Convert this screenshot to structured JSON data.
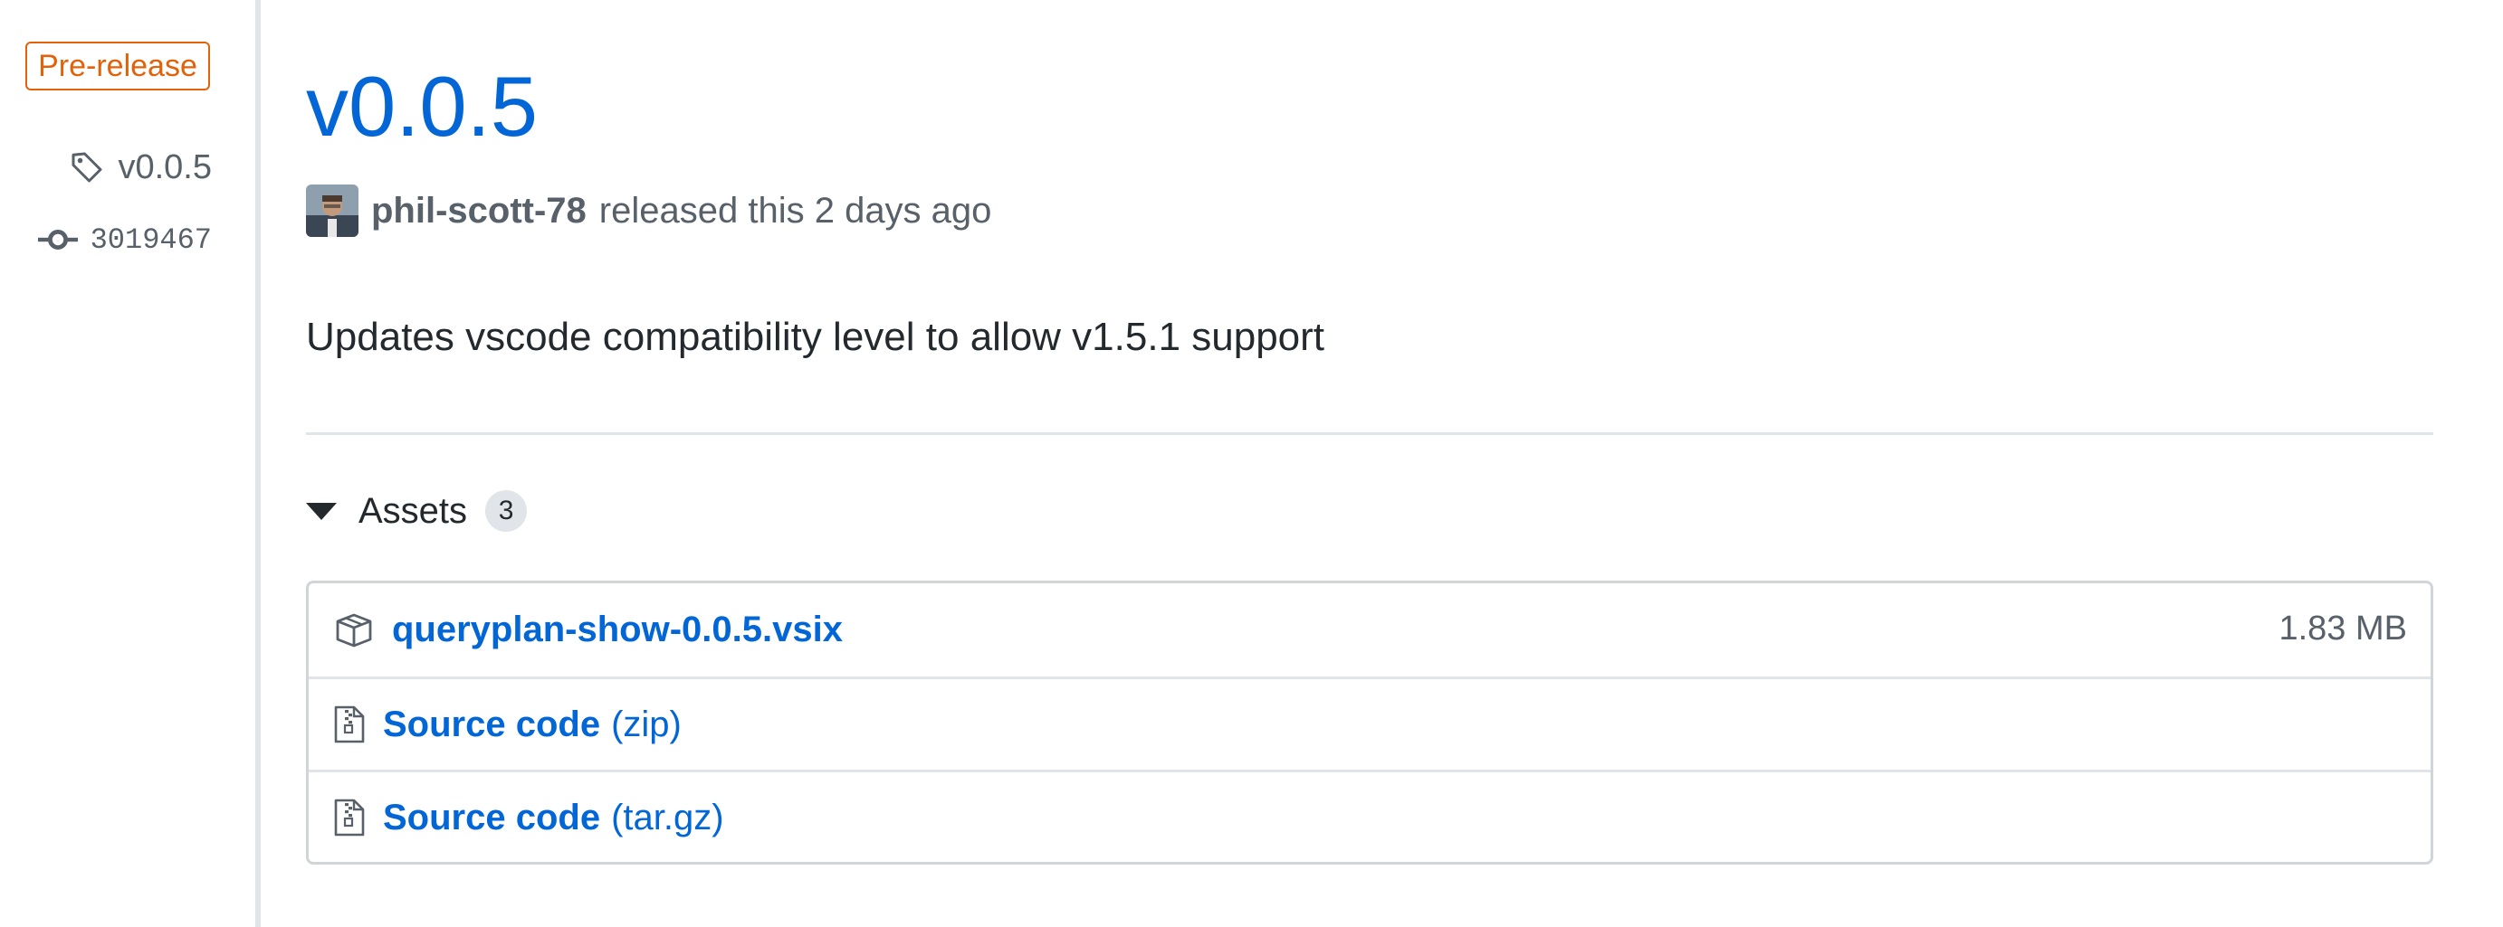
{
  "sidebar": {
    "prerelease_label": "Pre-release",
    "tag_label": "v0.0.5",
    "commit_label": "3019467"
  },
  "release": {
    "title": "v0.0.5",
    "author": "phil-scott-78",
    "released_text": "released this 2 days ago",
    "body": "Updates vscode compatibility level to allow v1.5.1 support"
  },
  "assets": {
    "heading": "Assets",
    "count": "3",
    "items": [
      {
        "name": "queryplan-show-0.0.5.vsix",
        "suffix": "",
        "size": "1.83 MB",
        "icon": "package-icon"
      },
      {
        "name": "Source code",
        "suffix": "(zip)",
        "size": "",
        "icon": "file-zip-icon"
      },
      {
        "name": "Source code",
        "suffix": "(tar.gz)",
        "size": "",
        "icon": "file-zip-icon"
      }
    ]
  },
  "colors": {
    "link": "#0366d6",
    "prerelease": "#e36209",
    "muted": "#586069",
    "border": "#e1e4e8"
  }
}
